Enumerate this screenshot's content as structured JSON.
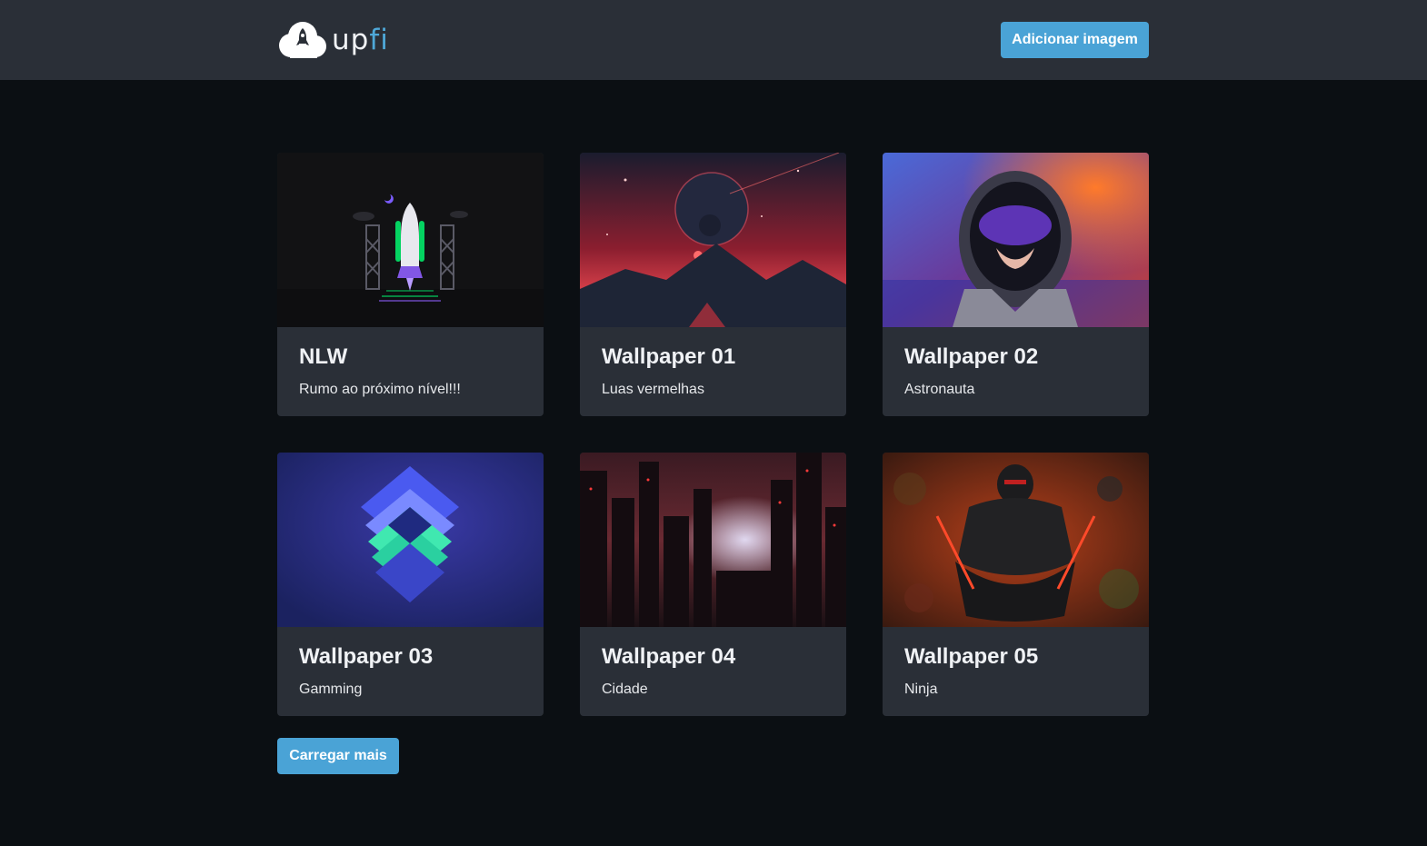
{
  "header": {
    "logo_prefix": "up",
    "logo_suffix": "fi",
    "add_button_label": "Adicionar imagem"
  },
  "cards": [
    {
      "title": "NLW",
      "description": "Rumo ao próximo nível!!!",
      "image": "rocket-launch-illustration"
    },
    {
      "title": "Wallpaper 01",
      "description": "Luas vermelhas",
      "image": "red-moons-landscape"
    },
    {
      "title": "Wallpaper 02",
      "description": "Astronauta",
      "image": "astronaut-portrait"
    },
    {
      "title": "Wallpaper 03",
      "description": "Gamming",
      "image": "layered-diamond-logo"
    },
    {
      "title": "Wallpaper 04",
      "description": "Cidade",
      "image": "dark-city-skyline"
    },
    {
      "title": "Wallpaper 05",
      "description": "Ninja",
      "image": "ninja-warrior"
    }
  ],
  "load_more_label": "Carregar mais",
  "colors": {
    "header_bg": "#2a2f37",
    "page_bg": "#0b0f13",
    "accent": "#4aa3d6",
    "card_bg": "#2a2f37"
  }
}
